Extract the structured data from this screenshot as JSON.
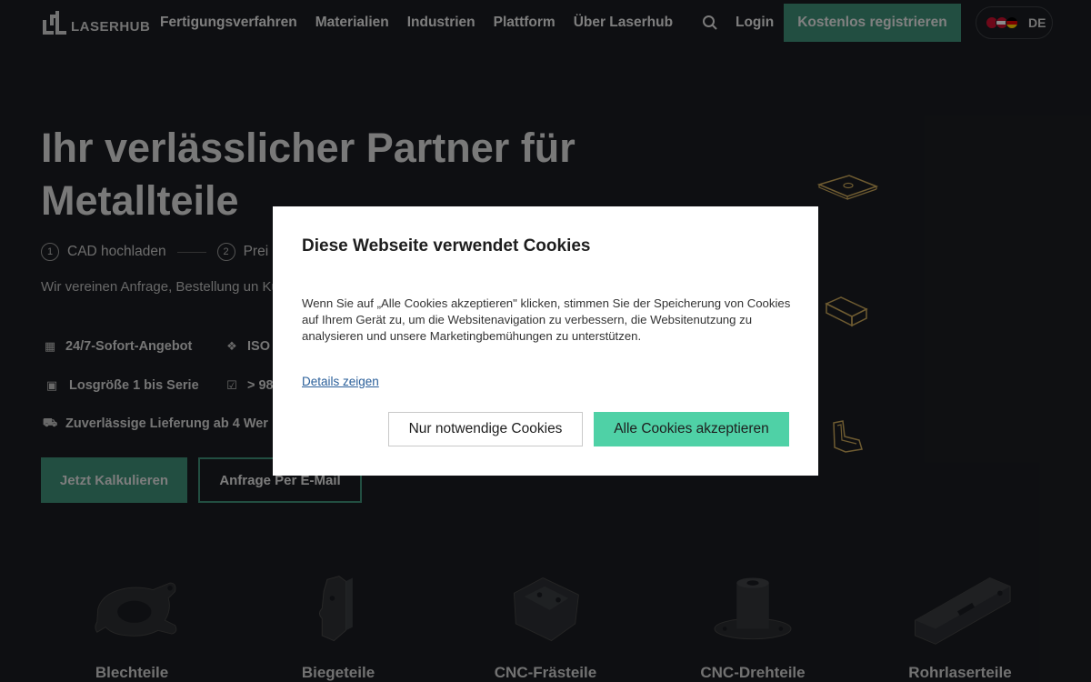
{
  "header": {
    "logo_text": "LASERHUB",
    "nav": [
      "Fertigungsverfahren",
      "Materialien",
      "Industrien",
      "Plattform",
      "Über Laserhub"
    ],
    "login_label": "Login",
    "register_label": "Kostenlos registrieren",
    "language": "DE"
  },
  "hero": {
    "title": "Ihr verlässlicher Partner für Metallteile",
    "steps": [
      {
        "num": "1",
        "label": "CAD hochladen"
      },
      {
        "num": "2",
        "label": "Prei"
      }
    ],
    "description": "Wir vereinen Anfrage, Bestellung un Kunststoffteilen in einem einfachen",
    "features": {
      "offer": "24/7-Sofort-Angebot",
      "iso": "ISO",
      "lot": "Losgröße 1 bis Serie",
      "rate": "> 98",
      "delivery": "Zuverlässige Lieferung ab 4 Wer"
    },
    "primary_button": "Jetzt Kalkulieren",
    "secondary_button": "Anfrage Per E-Mail"
  },
  "products": [
    "Blechteile",
    "Biegeteile",
    "CNC-Frästeile",
    "CNC-Drehteile",
    "Rohrlaserteile"
  ],
  "cookie_dialog": {
    "title": "Diese Webseite verwendet Cookies",
    "body": "Wenn Sie auf „Alle Cookies akzeptieren\" klicken, stimmen Sie der Speicherung von Cookies auf Ihrem Gerät zu, um die Websitenavigation zu verbessern, die Websitenutzung zu analysieren und unsere Marketingbemühungen zu unterstützen.",
    "details_link": "Details zeigen",
    "necessary_button": "Nur notwendige Cookies",
    "accept_button": "Alle Cookies akzeptieren"
  },
  "colors": {
    "background": "#1b1d21",
    "brand_green": "#3e8f77",
    "accept_green": "#4fd1a6",
    "link_blue": "#2a5f9a"
  }
}
